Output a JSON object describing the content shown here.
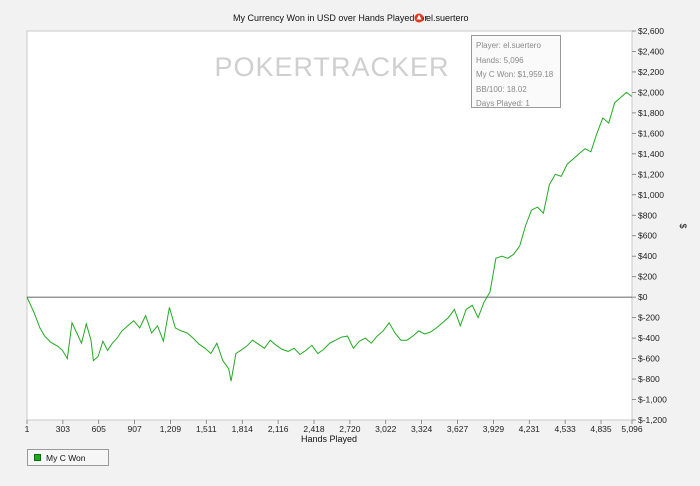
{
  "chart_data": {
    "type": "line",
    "title": "My Currency Won in USD over Hands Played for",
    "player_name": "el.suertero",
    "player_icon": "pokerstars-icon",
    "watermark": "POKERTRACKER",
    "watermark_colors": [
      "#cfcfcf",
      "#e2e2e2"
    ],
    "xlabel": "Hands Played",
    "ylabel": "$",
    "xlim": [
      1,
      5096
    ],
    "ylim": [
      -1200,
      2600
    ],
    "x_ticks": [
      1,
      303,
      605,
      907,
      1209,
      1511,
      1814,
      2116,
      2418,
      2720,
      3022,
      3324,
      3627,
      3929,
      4231,
      4533,
      4835,
      5096
    ],
    "x_tick_labels": [
      "1",
      "303",
      "605",
      "907",
      "1,209",
      "1,511",
      "1,814",
      "2,116",
      "2,418",
      "2,720",
      "3,022",
      "3,324",
      "3,627",
      "3,929",
      "4,231",
      "4,533",
      "4,835",
      "5,096"
    ],
    "y_ticks": [
      2600,
      2400,
      2200,
      2000,
      1800,
      1600,
      1400,
      1200,
      1000,
      800,
      600,
      400,
      200,
      0,
      -200,
      -400,
      -600,
      -800,
      -1000,
      -1200
    ],
    "y_tick_labels": [
      "$2,600",
      "$2,400",
      "$2,200",
      "$2,000",
      "$1,800",
      "$1,600",
      "$1,400",
      "$1,200",
      "$1,000",
      "$800",
      "$600",
      "$400",
      "$200",
      "$0",
      "$-200",
      "$-400",
      "$-600",
      "$-800",
      "$-1,000",
      "$-1,200"
    ],
    "grid": false,
    "zero_line": true,
    "series": [
      {
        "name": "My C Won",
        "color": "#22aa22",
        "x": [
          1,
          60,
          110,
          150,
          200,
          260,
          300,
          340,
          380,
          420,
          460,
          500,
          540,
          560,
          600,
          640,
          680,
          720,
          760,
          800,
          850,
          900,
          950,
          1000,
          1050,
          1100,
          1150,
          1200,
          1250,
          1300,
          1350,
          1400,
          1450,
          1500,
          1550,
          1600,
          1650,
          1700,
          1720,
          1760,
          1800,
          1850,
          1900,
          1950,
          2000,
          2050,
          2100,
          2150,
          2200,
          2250,
          2300,
          2350,
          2400,
          2450,
          2500,
          2550,
          2600,
          2650,
          2700,
          2750,
          2800,
          2850,
          2900,
          2950,
          3000,
          3050,
          3100,
          3150,
          3200,
          3250,
          3300,
          3350,
          3400,
          3450,
          3500,
          3550,
          3600,
          3650,
          3700,
          3750,
          3800,
          3850,
          3880,
          3900,
          3950,
          4000,
          4050,
          4100,
          4150,
          4200,
          4250,
          4300,
          4350,
          4400,
          4450,
          4500,
          4550,
          4600,
          4650,
          4700,
          4750,
          4800,
          4850,
          4900,
          4950,
          5000,
          5050,
          5096
        ],
        "y": [
          0,
          -150,
          -300,
          -380,
          -440,
          -480,
          -520,
          -600,
          -250,
          -350,
          -450,
          -260,
          -420,
          -620,
          -580,
          -430,
          -520,
          -450,
          -400,
          -330,
          -280,
          -230,
          -300,
          -180,
          -350,
          -280,
          -430,
          -100,
          -300,
          -330,
          -350,
          -400,
          -460,
          -500,
          -550,
          -450,
          -620,
          -700,
          -820,
          -550,
          -520,
          -480,
          -420,
          -460,
          -500,
          -420,
          -470,
          -510,
          -530,
          -500,
          -560,
          -520,
          -470,
          -550,
          -510,
          -450,
          -420,
          -390,
          -380,
          -500,
          -430,
          -400,
          -450,
          -380,
          -330,
          -250,
          -350,
          -420,
          -420,
          -380,
          -330,
          -360,
          -340,
          -300,
          -250,
          -200,
          -120,
          -280,
          -120,
          -80,
          -200,
          -50,
          10,
          50,
          380,
          400,
          380,
          420,
          500,
          700,
          850,
          880,
          820,
          1100,
          1200,
          1180,
          1300,
          1350,
          1400,
          1450,
          1420,
          1600,
          1750,
          1700,
          1900,
          1950,
          2000,
          1960
        ]
      }
    ]
  },
  "info_box": {
    "lines": [
      "Player: el.suertero",
      "Hands: 5,096",
      "My C Won: $1,959.18",
      "BB/100: 18.02",
      "Days Played: 1"
    ]
  },
  "legend": {
    "items": [
      {
        "label": "My C Won",
        "color": "#22aa22"
      }
    ]
  }
}
